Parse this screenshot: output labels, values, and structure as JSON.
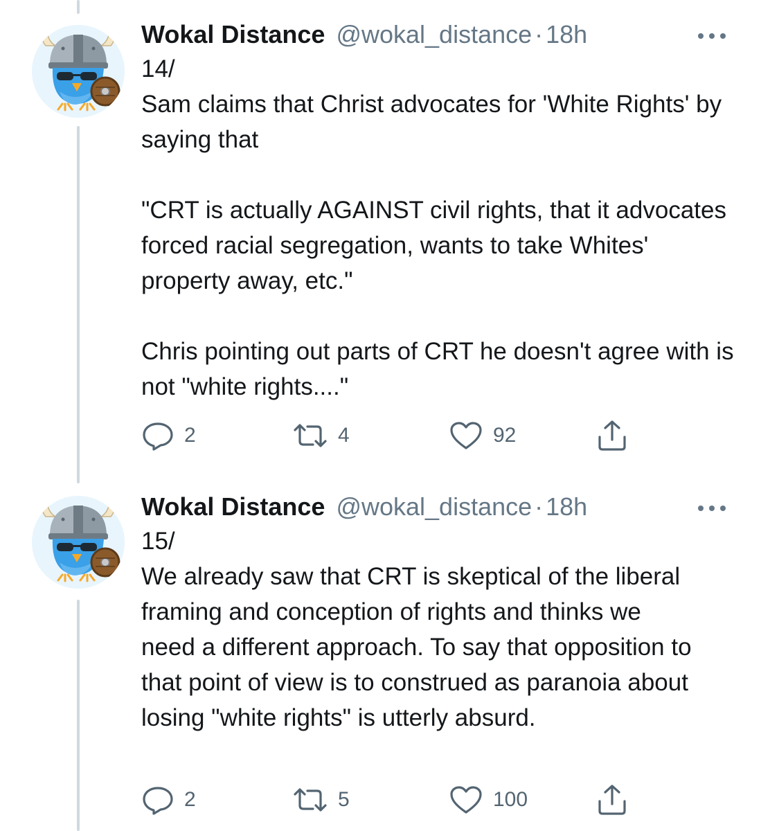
{
  "tweets": [
    {
      "author": {
        "display_name": "Wokal Distance",
        "handle": "@wokal_distance",
        "separator": "·",
        "time": "18h",
        "avatar_icon": "viking-bird-avatar-icon"
      },
      "paragraphs": [
        "14/",
        "Sam claims that Christ advocates for 'White Rights' by saying that",
        "\"CRT is actually AGAINST civil rights, that it advocates forced racial segregation, wants to take Whites' property away, etc.\"",
        "Chris pointing out parts of CRT he doesn't agree with is not \"white rights....\""
      ],
      "stats": {
        "replies": "2",
        "retweets": "4",
        "likes": "92"
      }
    },
    {
      "author": {
        "display_name": "Wokal Distance",
        "handle": "@wokal_distance",
        "separator": "·",
        "time": "18h",
        "avatar_icon": "viking-bird-avatar-icon"
      },
      "paragraphs": [
        "15/",
        "We already saw that CRT is skeptical of the liberal framing and conception of rights and thinks we need a different approach. To say that opposition to that point of view is to construed as paranoia about losing \"white rights\" is utterly absurd."
      ],
      "stats": {
        "replies": "2",
        "retweets": "5",
        "likes": "100"
      }
    }
  ],
  "icons": {
    "reply": "reply-icon",
    "retweet": "retweet-icon",
    "like": "heart-icon",
    "share": "share-icon",
    "more": "more-options-icon"
  },
  "colors": {
    "text": "#14171a",
    "secondary": "#657786",
    "thread_line": "#cfd9de",
    "avatar_bg": "#e8f5fd",
    "bird_blue": "#3aa0e8"
  }
}
